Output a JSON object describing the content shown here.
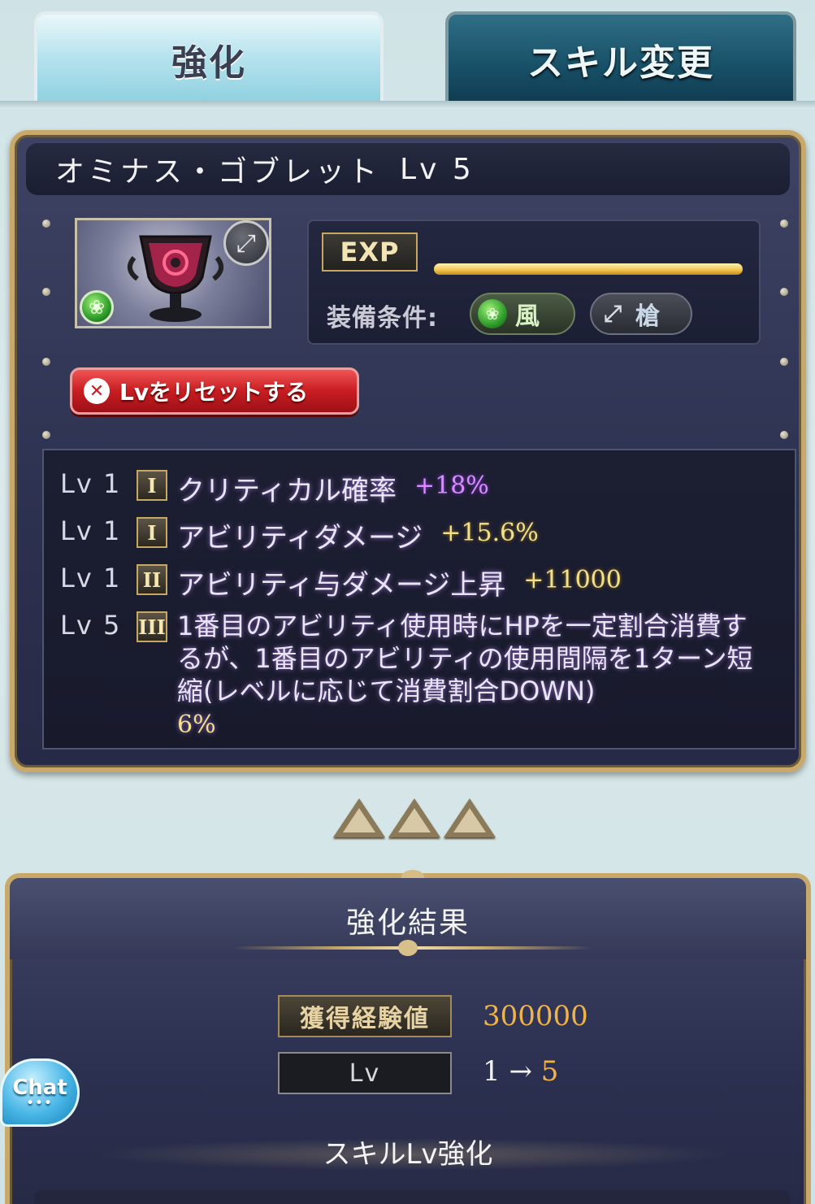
{
  "tabs": [
    {
      "label": "強化",
      "active": true
    },
    {
      "label": "スキル変更",
      "active": false
    }
  ],
  "weapon": {
    "name": "オミナス・ゴブレット",
    "level_label": "Lv 5",
    "element_icon": "wind-element-icon",
    "type_icon": "spear-icon",
    "exp_label": "EXP",
    "exp_fraction": 1.0,
    "equip_label": "装備条件:",
    "equip_conditions": [
      {
        "icon": "wind-element-icon",
        "label": "風"
      },
      {
        "icon": "spear-icon",
        "label": "槍"
      }
    ],
    "reset_button_label": "Lvをリセットする"
  },
  "skills": [
    {
      "lv": "Lv 1",
      "rank": "I",
      "name": "クリティカル確率",
      "value": "+18%",
      "value_color": "#d98cff"
    },
    {
      "lv": "Lv 1",
      "rank": "I",
      "name": "アビリティダメージ",
      "value": "+15.6%",
      "value_color": "#f2e08a"
    },
    {
      "lv": "Lv 1",
      "rank": "II",
      "name": "アビリティ与ダメージ上昇",
      "value": "+11000",
      "value_color": "#f2e08a"
    },
    {
      "lv": "Lv 5",
      "rank": "III",
      "name": "1番目のアビリティ使用時にHPを一定割合消費するが、1番目のアビリティの使用間隔を1ターン短縮(レベルに応じて消費割合DOWN)",
      "value": "6%",
      "value_color": "#f2e08a"
    }
  ],
  "result": {
    "title": "強化結果",
    "exp_gained_label": "獲得経験値",
    "exp_gained_value": "300000",
    "lv_label": "Lv",
    "lv_from": "1 →",
    "lv_to": "5",
    "skill_lv_title": "スキルLv強化"
  },
  "chat": {
    "label": "Chat",
    "dots": "•••"
  }
}
